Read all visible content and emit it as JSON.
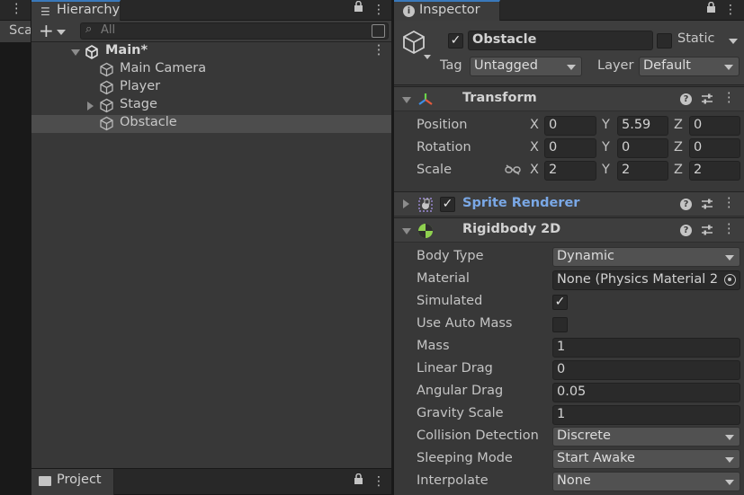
{
  "scene": {
    "tab_label_partial": "Sca"
  },
  "hierarchy": {
    "tab_label": "Hierarchy",
    "search_placeholder": "All",
    "scene_name": "Main*",
    "items": [
      {
        "label": "Main Camera",
        "has_children": false,
        "selected": false
      },
      {
        "label": "Player",
        "has_children": false,
        "selected": false
      },
      {
        "label": "Stage",
        "has_children": true,
        "selected": false
      },
      {
        "label": "Obstacle",
        "has_children": false,
        "selected": true
      }
    ]
  },
  "project": {
    "tab_label": "Project"
  },
  "inspector": {
    "tab_label": "Inspector",
    "object_name": "Obstacle",
    "active": true,
    "static_label": "Static",
    "static": false,
    "tag_label": "Tag",
    "tag_value": "Untagged",
    "layer_label": "Layer",
    "layer_value": "Default",
    "transform": {
      "title": "Transform",
      "position_label": "Position",
      "rotation_label": "Rotation",
      "scale_label": "Scale",
      "axis_x": "X",
      "axis_y": "Y",
      "axis_z": "Z",
      "position": {
        "x": "0",
        "y": "5.59",
        "z": "0"
      },
      "rotation": {
        "x": "0",
        "y": "0",
        "z": "0"
      },
      "scale": {
        "x": "2",
        "y": "2",
        "z": "2"
      }
    },
    "sprite_renderer": {
      "title": "Sprite Renderer",
      "enabled": true
    },
    "rigidbody": {
      "title": "Rigidbody 2D",
      "body_type_label": "Body Type",
      "body_type": "Dynamic",
      "material_label": "Material",
      "material": "None (Physics Material 2",
      "simulated_label": "Simulated",
      "simulated": true,
      "use_auto_mass_label": "Use Auto Mass",
      "use_auto_mass": false,
      "mass_label": "Mass",
      "mass": "1",
      "linear_drag_label": "Linear Drag",
      "linear_drag": "0",
      "angular_drag_label": "Angular Drag",
      "angular_drag": "0.05",
      "gravity_scale_label": "Gravity Scale",
      "gravity_scale": "1",
      "collision_detection_label": "Collision Detection",
      "collision_detection": "Discrete",
      "sleeping_mode_label": "Sleeping Mode",
      "sleeping_mode": "Start Awake",
      "interpolate_label": "Interpolate",
      "interpolate": "None"
    }
  },
  "icons": {
    "kebab": "⋮",
    "lock": "🔒",
    "check": "✓",
    "search": "⌕",
    "hierarchy": "☰",
    "info": "ⓘ",
    "help": "?",
    "plus": "+"
  },
  "colors": {
    "accent": "#3a79bb",
    "link_title": "#7aa8e6",
    "selection": "#4d4d4d"
  }
}
